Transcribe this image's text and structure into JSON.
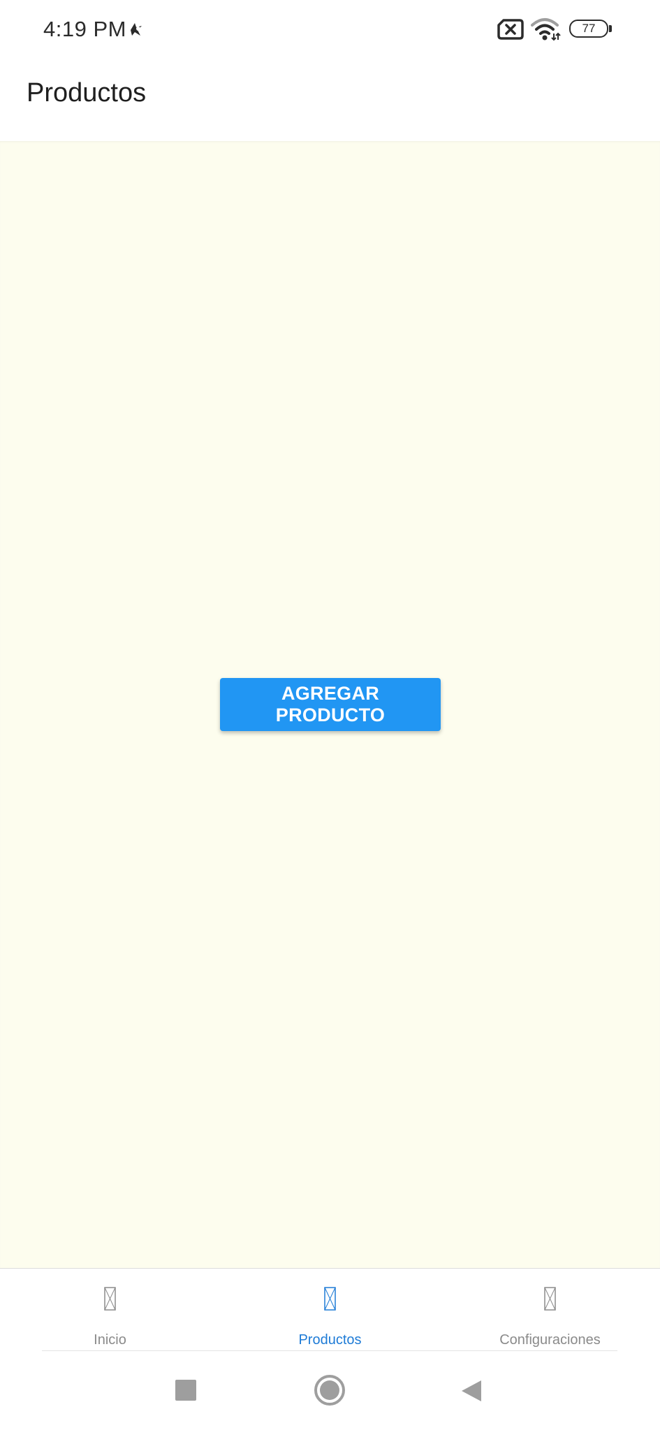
{
  "status_bar": {
    "time": "4:19 PM",
    "battery_level": "77",
    "notification_icon": "bird-icon",
    "sim_icon": "no-sim-icon",
    "wifi_icon": "wifi-icon"
  },
  "header": {
    "title": "Productos"
  },
  "main": {
    "add_button_label": "AGREGAR PRODUCTO",
    "background_color": "#fdfdee",
    "button_color": "#2196f3"
  },
  "tabs": [
    {
      "label": "Inicio",
      "icon": "missing-glyph-icon",
      "active": false
    },
    {
      "label": "Productos",
      "icon": "missing-glyph-icon",
      "active": true
    },
    {
      "label": "Configuraciones",
      "icon": "missing-glyph-icon",
      "active": false
    }
  ],
  "colors": {
    "active_tab": "#1e7bd6",
    "inactive_tab": "#8a8a8a"
  },
  "nav_bar": {
    "recents_icon": "square-icon",
    "home_icon": "circle-home-icon",
    "back_icon": "triangle-back-icon"
  }
}
